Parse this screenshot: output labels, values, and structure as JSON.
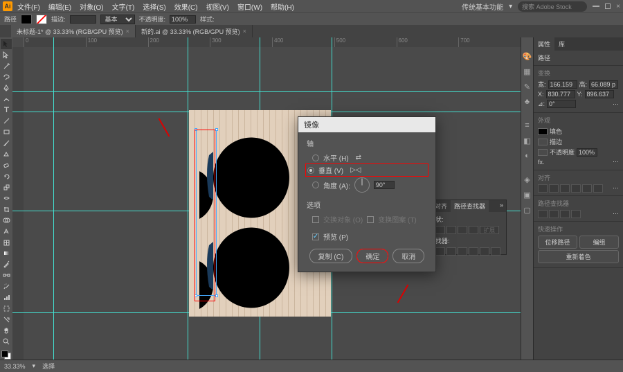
{
  "menu": {
    "items": [
      "文件(F)",
      "编辑(E)",
      "对象(O)",
      "文字(T)",
      "选择(S)",
      "效果(C)",
      "视图(V)",
      "窗口(W)",
      "帮助(H)"
    ],
    "workspace": "传统基本功能",
    "search_placeholder": "搜索 Adobe Stock"
  },
  "control": {
    "label1": "路径",
    "stroke_label": "描边:",
    "stroke_val": "",
    "uniform": "基本",
    "opacity_label": "不透明度:",
    "opacity_val": "100%",
    "style_label": "样式:"
  },
  "tabs": {
    "a": "未标题-1* @ 33.33% (RGB/GPU 预览)",
    "b": "新的.ai @ 33.33% (RGB/GPU 预览)"
  },
  "ruler_marks": [
    "0",
    "100",
    "200",
    "300",
    "400",
    "500",
    "600",
    "700"
  ],
  "dialog": {
    "title": "镜像",
    "axis": "轴",
    "horizontal": "水平 (H)",
    "vertical": "垂直 (V)",
    "angle": "角度 (A):",
    "angle_val": "90°",
    "options": "选项",
    "opt1": "交换对象 (O)",
    "opt2": "变换图案 (T)",
    "preview": "预览 (P)",
    "copy": "复制 (C)",
    "ok": "确定",
    "cancel": "取消"
  },
  "docked": {
    "tab1": "对齐",
    "tab2": "路径查找器",
    "sec1": "状:",
    "sec2": "找器:",
    "expand": "扩展"
  },
  "right": {
    "tabs": [
      "属性",
      "库"
    ],
    "path": "路径",
    "transform": "变换",
    "w": "宽:",
    "w_val": "166.159",
    "h": "高:",
    "h_val": "66.089 p",
    "x": "X:",
    "x_val": "830.777",
    "y": "Y:",
    "y_val": "896.637",
    "rot": "⊿:",
    "rot_val": "0°",
    "appearance": "外观",
    "fill": "填色",
    "stroke": "描边",
    "opacity": "不透明度",
    "opacity_val": "100%",
    "fx": "fx.",
    "align": "对齐",
    "pathfinder": "路径查找器",
    "quick": "快速操作",
    "btn1": "位移路径",
    "btn2": "编组",
    "btn3": "重新着色"
  },
  "status": {
    "zoom": "33.33%",
    "tool": "选择"
  }
}
